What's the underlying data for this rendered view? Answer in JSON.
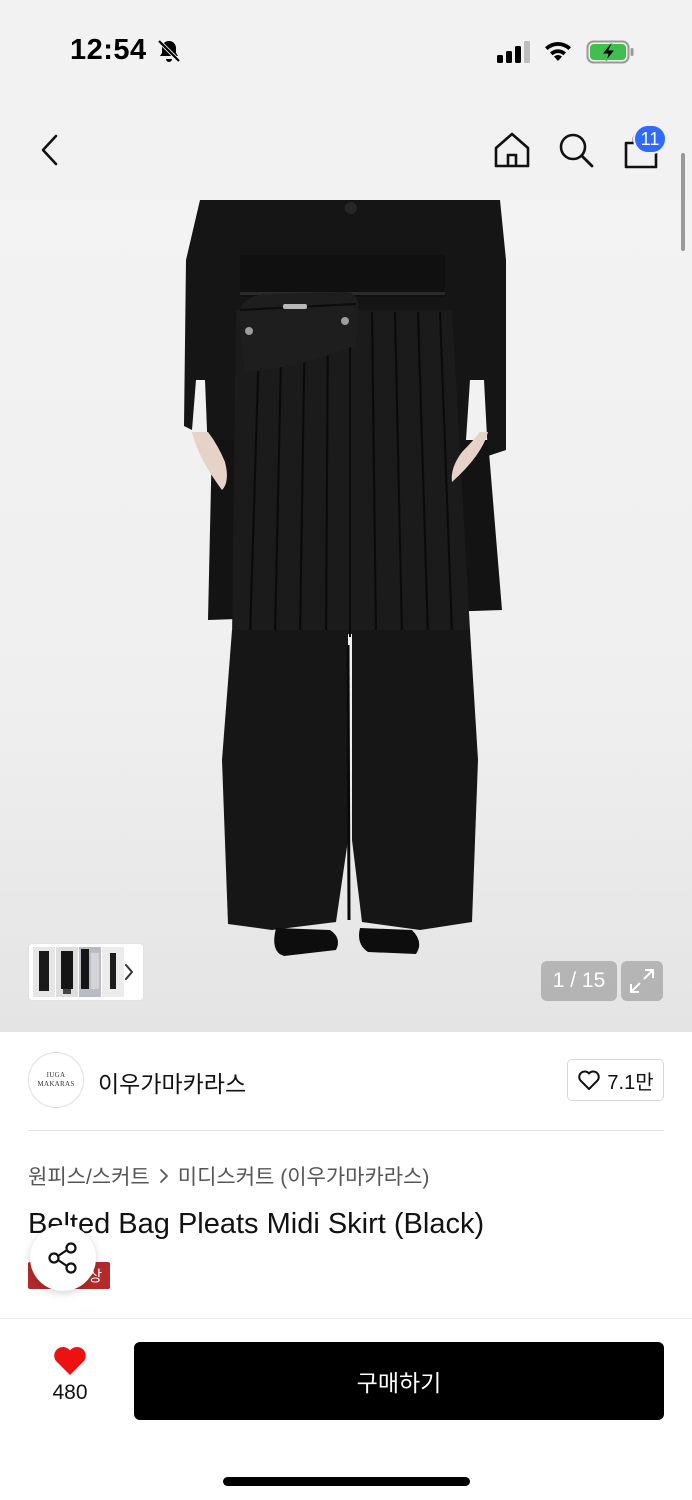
{
  "status_bar": {
    "time": "12:54",
    "icons": [
      "bell-slash-icon",
      "signal-icon",
      "wifi-icon",
      "battery-charging-icon"
    ]
  },
  "nav": {
    "icons": [
      "chevron-left-icon",
      "home-icon",
      "search-icon",
      "shopping-bag-icon"
    ],
    "cart_count": "11"
  },
  "gallery": {
    "current": "1 / 15",
    "current_index": 1,
    "total": 15
  },
  "brand": {
    "logo_line1": "IUGA",
    "logo_line2": "MAKARAS",
    "name": "이우가마카라스",
    "likes": "7.1만"
  },
  "breadcrumb": {
    "category": "원피스/스커트",
    "subcategory": "미디스커트 (이우가마카라스)"
  },
  "product": {
    "title": "Belted Bag Pleats Midi Skirt (Black)",
    "tag": "상"
  },
  "bottom_bar": {
    "wish_count": "480",
    "buy_label": "구매하기"
  },
  "colors": {
    "accent_blue": "#2f6bff",
    "heart_red": "#ee1111",
    "tag_red": "#b42a2a",
    "buy_black": "#000000"
  }
}
